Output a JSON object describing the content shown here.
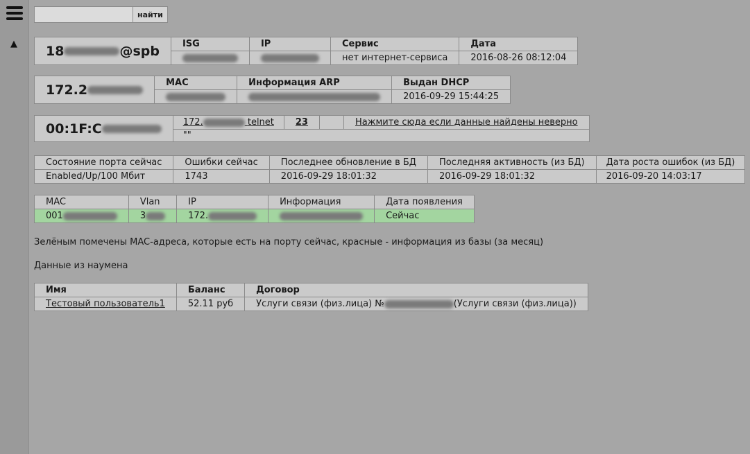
{
  "sidebar": {
    "menu_icon": "hamburger-icon",
    "up_icon": "triangle-up-icon",
    "up_glyph": "▲"
  },
  "search": {
    "value": "",
    "button": "найти"
  },
  "isg_block": {
    "login_suffix": "@spb",
    "headers": [
      "ISG",
      "IP",
      "Сервис",
      "Дата"
    ],
    "service": "нет интернет-сервиса",
    "date": "2016-08-26 08:12:04"
  },
  "ip_block": {
    "ip_prefix": "172.2",
    "headers": [
      "MAC",
      "Информация ARP",
      "Выдан DHCP"
    ],
    "dhcp_date": "2016-09-29 15:44:25"
  },
  "mac_block": {
    "mac_prefix": "00:1F:C",
    "telnet_prefix": "172.",
    "telnet_label": "telnet",
    "port": "23",
    "report_link": "Нажмите сюда если данные найдены неверно",
    "quotes": "\"\""
  },
  "port_state": {
    "headers": [
      "Состояние порта сейчас",
      "Ошибки сейчас",
      "Последнее обновление в БД",
      "Последняя активность (из БД)",
      "Дата роста ошибок (из БД)"
    ],
    "values": [
      "Enabled/Up/100 Мбит",
      "1743",
      "2016-09-29 18:01:32",
      "2016-09-29 18:01:32",
      "2016-09-20 14:03:17"
    ]
  },
  "mac_table": {
    "headers": [
      "MAC",
      "Vlan",
      "IP",
      "Информация",
      "Дата появления"
    ],
    "row": {
      "mac": "001",
      "vlan": "3",
      "ip": "172.",
      "info": "",
      "appeared": "Сейчас"
    }
  },
  "legend_note": "Зелёным помечены MAC-адреса, которые есть на порту сейчас, красные - информация из базы (за месяц)",
  "naumen_title": "Данные из наумена",
  "naumen_table": {
    "headers": [
      "Имя",
      "Баланс",
      "Договор"
    ],
    "row": {
      "name": "Тестовый пользователь1",
      "balance": "52.11 руб",
      "contract_prefix": "Услуги связи (физ.лица) №",
      "contract_suffix": "(Услуги связи (физ.лица))"
    }
  }
}
